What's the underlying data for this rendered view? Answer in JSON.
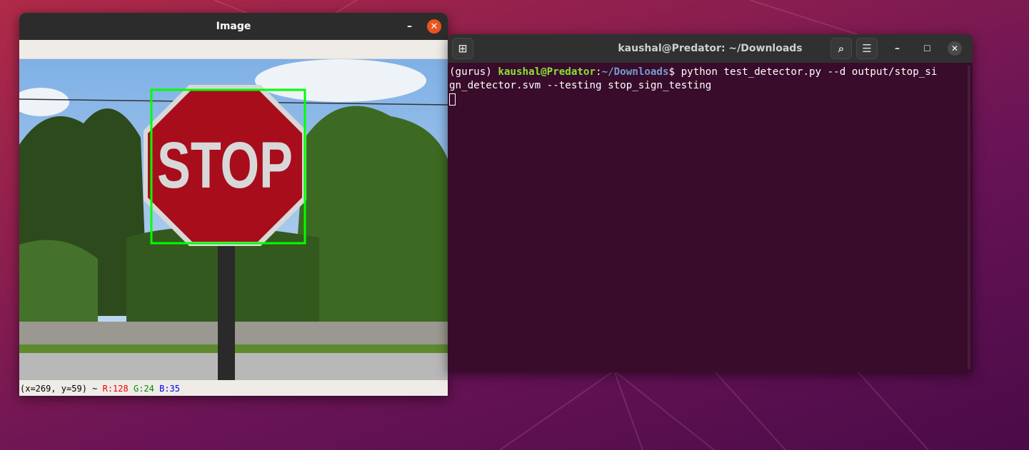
{
  "image_window": {
    "title": "Image",
    "minimize_icon": "minimize-icon",
    "close_icon": "close-icon",
    "status": {
      "coords": "(x=269, y=59) ~",
      "r": "R:128",
      "g": "G:24",
      "b": "B:35"
    },
    "sign_text": "STOP",
    "colors": {
      "box": "#00ff00",
      "sign": "#a80d1c"
    }
  },
  "terminal": {
    "title": "kaushal@Predator: ~/Downloads",
    "prompt": {
      "env": "(gurus) ",
      "user": "kaushal@Predator",
      "sep": ":",
      "path": "~/Downloads",
      "dollar": "$ "
    },
    "command_line1": "python test_detector.py --d output/stop_si",
    "command_line2": "gn_detector.svm --testing stop_sign_testing"
  }
}
